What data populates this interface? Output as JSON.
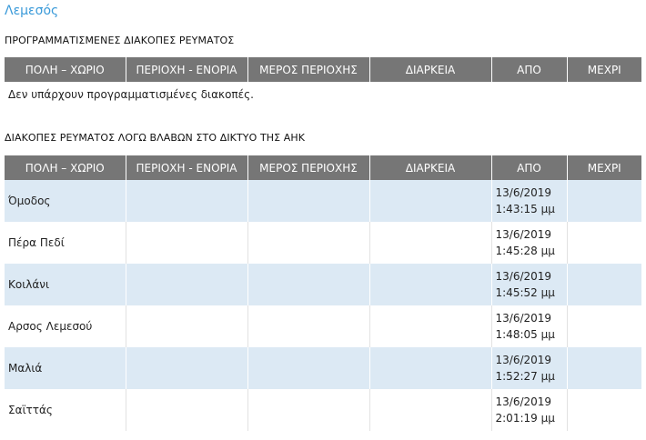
{
  "region": "Λεμεσός",
  "scheduled": {
    "title": "ΠΡΟΓΡΑΜΜΑΤΙΣΜΕΝΕΣ ΔΙΑΚΟΠΕΣ ΡΕΥΜΑΤΟΣ",
    "headers": [
      "ΠΟΛΗ – ΧΩΡΙΟ",
      "ΠΕΡΙΟΧΗ - ΕΝΟΡΙΑ",
      "ΜΕΡΟΣ ΠΕΡΙΟΧΗΣ",
      "ΔΙΑΡΚΕΙΑ",
      "ΑΠΟ",
      "ΜΕΧΡΙ"
    ],
    "empty_message": "Δεν υπάρχουν προγραμματισμένες διακοπές."
  },
  "faults": {
    "title": "ΔΙΑΚΟΠΕΣ ΡΕΥΜΑΤΟΣ ΛΟΓΩ ΒΛΑΒΩΝ ΣΤΟ ΔΙΚΤΥΟ ΤΗΣ ΑΗΚ",
    "headers": [
      "ΠΟΛΗ – ΧΩΡΙΟ",
      "ΠΕΡΙΟΧΗ - ΕΝΟΡΙΑ",
      "ΜΕΡΟΣ ΠΕΡΙΟΧΗΣ",
      "ΔΙΑΡΚΕΙΑ",
      "ΑΠΟ",
      "ΜΕΧΡΙ"
    ],
    "rows": [
      {
        "city": "Όμοδος",
        "area": "",
        "part": "",
        "duration": "",
        "from_date": "13/6/2019",
        "from_time": "1:43:15 μμ",
        "to": ""
      },
      {
        "city": "Πέρα Πεδί",
        "area": "",
        "part": "",
        "duration": "",
        "from_date": "13/6/2019",
        "from_time": "1:45:28 μμ",
        "to": ""
      },
      {
        "city": "Κοιλάνι",
        "area": "",
        "part": "",
        "duration": "",
        "from_date": "13/6/2019",
        "from_time": "1:45:52 μμ",
        "to": ""
      },
      {
        "city": "Αρσος Λεμεσού",
        "area": "",
        "part": "",
        "duration": "",
        "from_date": "13/6/2019",
        "from_time": "1:48:05 μμ",
        "to": ""
      },
      {
        "city": "Μαλιά",
        "area": "",
        "part": "",
        "duration": "",
        "from_date": "13/6/2019",
        "from_time": "1:52:27 μμ",
        "to": ""
      },
      {
        "city": "Σαϊττάς",
        "area": "",
        "part": "",
        "duration": "",
        "from_date": "13/6/2019",
        "from_time": "2:01:19 μμ",
        "to": ""
      }
    ]
  }
}
